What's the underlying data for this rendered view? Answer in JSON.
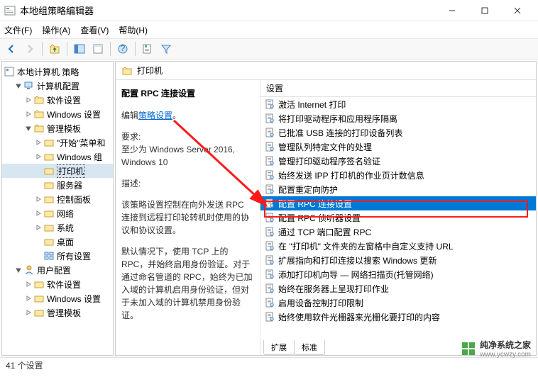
{
  "window": {
    "title": "本地组策略编辑器",
    "buttons": {
      "min": "minimize",
      "max": "maximize",
      "close": "close"
    }
  },
  "menubar": {
    "file": "文件(F)",
    "action": "操作(A)",
    "view": "查看(V)",
    "help": "帮助(H)"
  },
  "tree": {
    "root": "本地计算机 策略",
    "computer": "计算机配置",
    "software1": "软件设置",
    "windows1": "Windows 设置",
    "admin1": "管理模板",
    "startmenu": "\"开始\"菜单和",
    "wincomp": "Windows 组",
    "printers": "打印机",
    "servers": "服务器",
    "ctrlpanel": "控制面板",
    "network": "网络",
    "system": "系统",
    "desktop": "桌面",
    "allsettings": "所有设置",
    "user": "用户配置",
    "software2": "软件设置",
    "windows2": "Windows 设置",
    "admin2": "管理模板"
  },
  "content": {
    "header": "打印机",
    "desc": {
      "title": "配置 RPC 连接设置",
      "edit_prefix": "编辑",
      "edit_link": "策略设置",
      "req_label": "要求:",
      "req_text": "至少为 Windows Server 2016, Windows 10",
      "desc_label": "描述:",
      "desc_p1": "该策略设置控制在向外发送 RPC 连接到远程打印轮转机时使用的协议和协议设置。",
      "desc_p2": "默认情况下，使用 TCP 上的 RPC，并始终启用身份验证。对于通过命名管道的 RPC，始终为已加入域的计算机启用身份验证，但对于未加入域的计算机禁用身份验证。"
    },
    "list_header": "设置",
    "items": [
      "激活 Internet 打印",
      "将打印驱动程序和应用程序隔离",
      "已批准 USB 连接的打印设备列表",
      "管理队列特定文件的处理",
      "管理打印驱动程序签名验证",
      "始终发送 IPP 打印机的作业页计数信息",
      "配置重定向防护",
      "配置 RPC 连接设置",
      "配置 RPC 侦听器设置",
      "通过 TCP 端口配置 RPC",
      "在 \"打印机\" 文件夹的左窗格中自定义支持 URL",
      "扩展指向和打印连接以搜索 Windows 更新",
      "添加打印机向导 — 网络扫描页(托管网络)",
      "始终在服务器上呈现打印作业",
      "启用设备控制打印限制",
      "始终使用软件光栅器来光栅化要打印的内容"
    ],
    "selected_index": 7
  },
  "tabs": {
    "extended": "扩展",
    "standard": "标准"
  },
  "status": "41 个设置",
  "watermark": {
    "name": "纯净系统之家",
    "url": "www.ycwzy.com"
  }
}
